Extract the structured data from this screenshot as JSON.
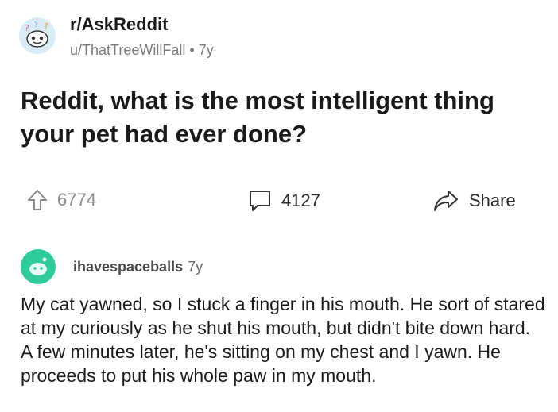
{
  "post": {
    "subreddit": "r/AskReddit",
    "author": "u/ThatTreeWillFall",
    "separator": "•",
    "age": "7y",
    "title": "Reddit, what is the most intelligent thing your pet had ever done?",
    "upvotes": "6774",
    "comments": "4127",
    "share_label": "Share"
  },
  "comment": {
    "username": "ihavespaceballs",
    "age": "7y",
    "body": "My cat yawned, so I stuck a finger in his mouth. He sort of stared at my curiously as he shut his mouth, but didn't bite down hard. A few minutes later, he's sitting on my chest and I yawn. He proceeds to put his whole paw in my mouth."
  },
  "icons": {
    "subreddit_avatar": "askreddit-snoo-icon",
    "upvote": "upvote-arrow-icon",
    "comments": "comment-bubble-icon",
    "share": "share-arrow-icon",
    "user_avatar": "user-avatar-icon"
  },
  "colors": {
    "sub_avatar_bg": "#d9ecf7",
    "user_avatar_bg": "#2ecc9a",
    "meta_text": "#7c7c7c"
  }
}
